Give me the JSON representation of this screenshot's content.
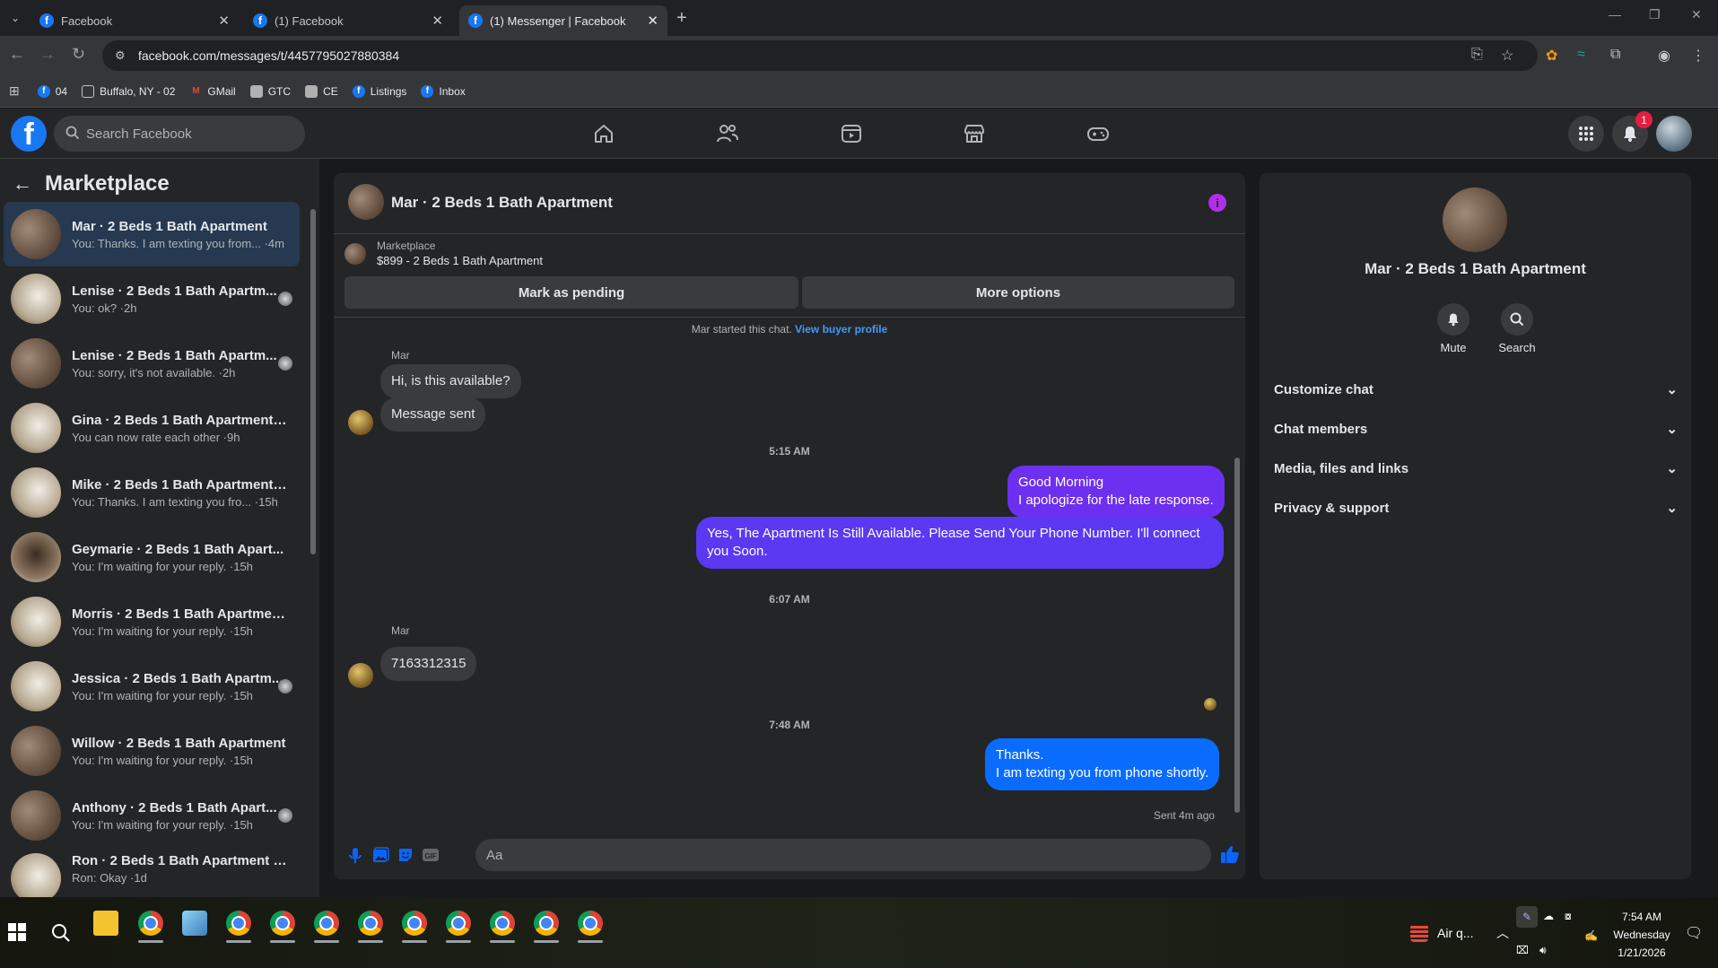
{
  "browser": {
    "tabs": [
      {
        "title": "Facebook",
        "active": false
      },
      {
        "title": "(1) Facebook",
        "active": false
      },
      {
        "title": "(1) Messenger | Facebook",
        "active": true
      }
    ],
    "url": "facebook.com/messages/t/4457795027880384",
    "bookmarks": [
      {
        "label": "04",
        "icon": "facebook-icon"
      },
      {
        "label": "Buffalo, NY - 02",
        "icon": "folder-icon"
      },
      {
        "label": "GMail",
        "icon": "gmail-icon"
      },
      {
        "label": "GTC",
        "icon": "image-icon"
      },
      {
        "label": "CE",
        "icon": "image-icon"
      },
      {
        "label": "Listings",
        "icon": "facebook-icon"
      },
      {
        "label": "Inbox",
        "icon": "facebook-icon"
      }
    ]
  },
  "fb": {
    "search_placeholder": "Search Facebook",
    "notification_count": "1"
  },
  "left": {
    "title": "Marketplace",
    "conversations": [
      {
        "name": "Mar · 2 Beds 1 Bath Apartment",
        "preview": "You: Thanks. I am texting you from... ·4m",
        "avatar": "wood",
        "selected": true
      },
      {
        "name": "Lenise · 2 Beds 1 Bath Apartm...",
        "preview": "You: ok? ·2h",
        "avatar": "white"
      },
      {
        "name": "Lenise · 2 Beds 1 Bath Apartm...",
        "preview": "You: sorry, it's not available. ·2h",
        "avatar": "wood"
      },
      {
        "name": "Gina · 2 Beds 1 Bath Apartment f...",
        "preview": "You can now rate each other ·9h",
        "avatar": "white"
      },
      {
        "name": "Mike · 2 Beds 1 Bath Apartment ...",
        "preview": "You: Thanks. I am texting you fro... ·15h",
        "avatar": "white"
      },
      {
        "name": "Geymarie · 2 Beds 1 Bath Apart...",
        "preview": "You: I'm waiting for your reply. ·15h",
        "avatar": "dark"
      },
      {
        "name": "Morris · 2 Beds 1 Bath Apartmen...",
        "preview": "You: I'm waiting for your reply. ·15h",
        "avatar": "white"
      },
      {
        "name": "Jessica · 2 Beds 1 Bath Apartm...",
        "preview": "You: I'm waiting for your reply. ·15h",
        "avatar": "white"
      },
      {
        "name": "Willow · 2 Beds 1 Bath Apartment",
        "preview": "You: I'm waiting for your reply. ·15h",
        "avatar": "wood"
      },
      {
        "name": "Anthony · 2 Beds 1 Bath Apart...",
        "preview": "You: I'm waiting for your reply. ·15h",
        "avatar": "wood"
      },
      {
        "name": "Ron · 2 Beds 1 Bath Apartment f...",
        "preview": "Ron: Okay ·1d",
        "avatar": "white"
      }
    ]
  },
  "chat": {
    "title": "Mar · 2 Beds 1 Bath Apartment",
    "listing_source": "Marketplace",
    "listing_title": "$899 - 2 Beds 1 Bath Apartment",
    "mark_pending": "Mark as pending",
    "more_options": "More options",
    "started": "Mar started this chat.",
    "buyer_profile": "View buyer profile",
    "sender_name": "Mar",
    "in1": "Hi, is this available?",
    "in2": "Message sent",
    "ts1": "5:15 AM",
    "out1_line1": "Good Morning",
    "out1_line2": "I apologize for the late response.",
    "out2": "Yes, The Apartment Is Still Available. Please Send Your Phone Number. I'll connect you Soon.",
    "ts2": "6:07 AM",
    "in3": "7163312315",
    "ts3": "7:48 AM",
    "out3_line1": "Thanks.",
    "out3_line2": "I am texting you from phone shortly.",
    "sent_status": "Sent 4m ago",
    "composer_placeholder": "Aa",
    "colors": {
      "bubble_purple": "#6d2ff0",
      "bubble_blue": "#0a6cff"
    }
  },
  "right": {
    "name": "Mar · 2 Beds 1 Bath Apartment",
    "mute": "Mute",
    "search": "Search",
    "sections": [
      "Customize chat",
      "Chat members",
      "Media, files and links",
      "Privacy & support"
    ]
  },
  "taskbar": {
    "weather": "Air q...",
    "time": "7:54 AM",
    "day": "Wednesday",
    "date": "1/21/2026"
  }
}
